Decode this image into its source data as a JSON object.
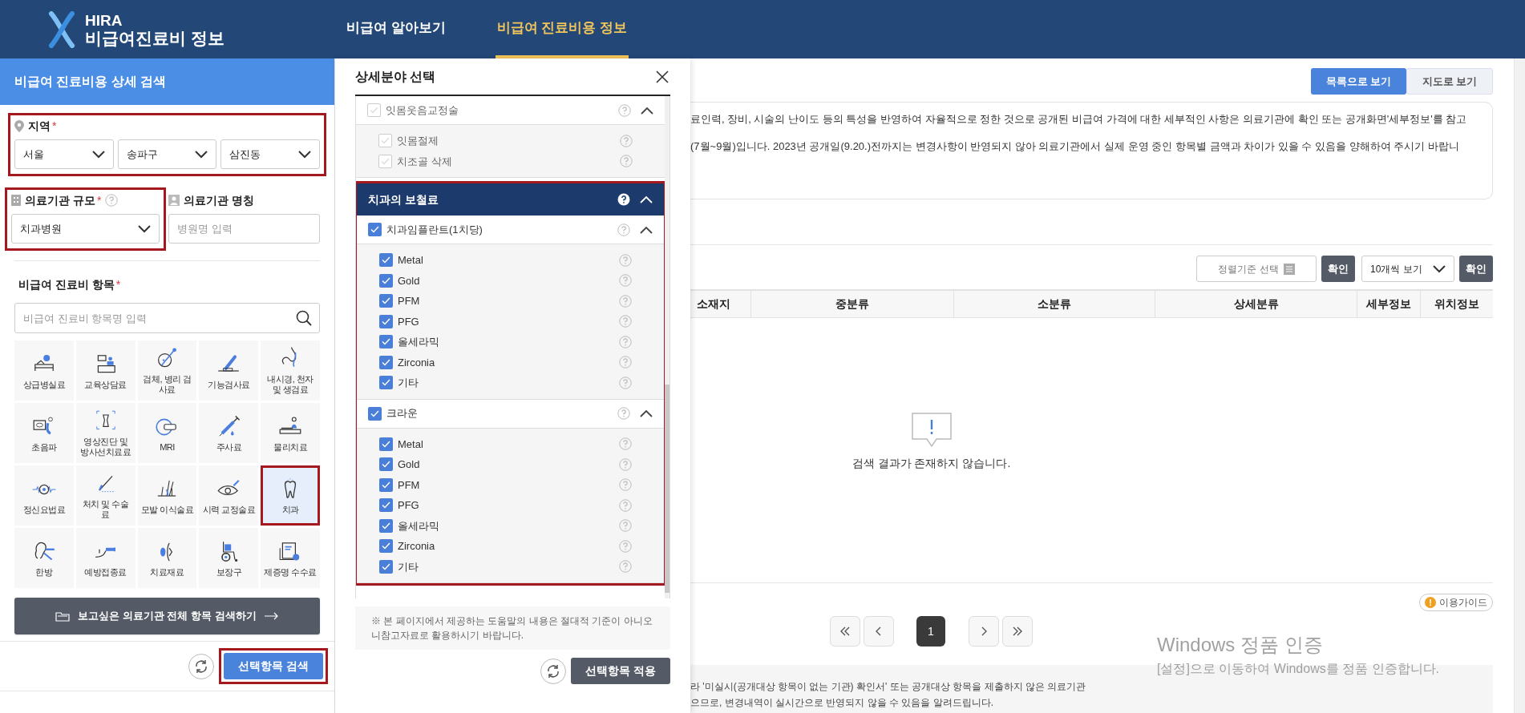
{
  "header": {
    "title_top": "HIRA",
    "title_bottom": "비급여진료비 정보",
    "nav": [
      {
        "label": "비급여 알아보기",
        "selected": false
      },
      {
        "label": "비급여 진료비용 정보",
        "selected": true
      }
    ]
  },
  "search_panel": {
    "title": "비급여 진료비용 상세 검색",
    "region": {
      "label": "지역",
      "required": "*",
      "highlighted": true,
      "selects": [
        "서울",
        "송파구",
        "삼진동"
      ]
    },
    "scale": {
      "label": "의료기관 규모",
      "required": "*",
      "value": "치과병원",
      "highlighted": true
    },
    "name_field": {
      "label": "의료기관 명칭",
      "placeholder": "병원명 입력"
    },
    "items": {
      "label": "비급여 진료비 항목",
      "required": "*",
      "placeholder": "비급여 진료비 항목명 입력"
    },
    "categories": [
      {
        "label": "상급병실료",
        "selected": false,
        "highlighted": false
      },
      {
        "label": "교육상담료",
        "selected": false,
        "highlighted": false
      },
      {
        "label": "검체, 병리 검사료",
        "selected": false,
        "highlighted": false
      },
      {
        "label": "기능검사료",
        "selected": false,
        "highlighted": false
      },
      {
        "label": "내시경, 천자 및 생검료",
        "selected": false,
        "highlighted": false
      },
      {
        "label": "초음파",
        "selected": false,
        "highlighted": false
      },
      {
        "label": "영상진단 및 방사선치료료",
        "selected": false,
        "highlighted": false
      },
      {
        "label": "MRI",
        "selected": false,
        "highlighted": false
      },
      {
        "label": "주사료",
        "selected": false,
        "highlighted": false
      },
      {
        "label": "물리치료",
        "selected": false,
        "highlighted": false
      },
      {
        "label": "정신요법료",
        "selected": false,
        "highlighted": false
      },
      {
        "label": "처치 및 수술료",
        "selected": false,
        "highlighted": false
      },
      {
        "label": "모발 이식술료",
        "selected": false,
        "highlighted": false
      },
      {
        "label": "시력 교정술료",
        "selected": false,
        "highlighted": false
      },
      {
        "label": "치과",
        "selected": true,
        "highlighted": true
      },
      {
        "label": "한방",
        "selected": false,
        "highlighted": false
      },
      {
        "label": "예방접종료",
        "selected": false,
        "highlighted": false
      },
      {
        "label": "치료재료",
        "selected": false,
        "highlighted": false
      },
      {
        "label": "보장구",
        "selected": false,
        "highlighted": false
      },
      {
        "label": "제증명 수수료",
        "selected": false,
        "highlighted": false
      }
    ],
    "all_items_button": "보고싶은 의료기관 전체 항목 검색하기",
    "search_button": {
      "label": "선택항목 검색",
      "highlighted": true
    }
  },
  "detail_panel": {
    "title": "상세분야 선택",
    "groups": [
      {
        "label": "잇몸웃음교정술",
        "checked": false,
        "expanded": true,
        "children": [
          {
            "label": "잇몸절제",
            "checked": false
          },
          {
            "label": "치조골 삭제",
            "checked": false
          }
        ]
      }
    ],
    "sections": [
      {
        "title": "치과의 보철료",
        "highlighted": true,
        "expanded": true,
        "groups": [
          {
            "label": "치과임플란트(1치당)",
            "checked": true,
            "expanded": true,
            "children": [
              {
                "label": "Metal",
                "checked": true
              },
              {
                "label": "Gold",
                "checked": true
              },
              {
                "label": "PFM",
                "checked": true
              },
              {
                "label": "PFG",
                "checked": true
              },
              {
                "label": "올세라믹",
                "checked": true
              },
              {
                "label": "Zirconia",
                "checked": true
              },
              {
                "label": "기타",
                "checked": true
              }
            ]
          },
          {
            "label": "크라운",
            "checked": true,
            "expanded": true,
            "children": [
              {
                "label": "Metal",
                "checked": true
              },
              {
                "label": "Gold",
                "checked": true
              },
              {
                "label": "PFM",
                "checked": true
              },
              {
                "label": "PFG",
                "checked": true
              },
              {
                "label": "올세라믹",
                "checked": true
              },
              {
                "label": "Zirconia",
                "checked": true
              },
              {
                "label": "기타",
                "checked": true
              }
            ]
          }
        ]
      }
    ],
    "note": "※ 본 페이지에서 제공하는 도움말의 내용은 절대적 기준이 아니오니참고자료로 활용하시기 바랍니다.",
    "apply_button": "선택항목 적용"
  },
  "main": {
    "view_tabs": [
      {
        "label": "목록으로 보기",
        "selected": true
      },
      {
        "label": "지도로 보기",
        "selected": false
      }
    ],
    "notice": [
      "료인력, 장비, 시술의 난이도 등의 특성을 반영하여 자율적으로 정한 것으로 공개된 비급여 가격에 대한 세부적인 사항은 의료기관에 확인 또는 공개화면'세부정보'를 참고",
      "(7월~9월)입니다. 2023년 공개일(9.20.)전까지는 변경사항이 반영되지 않아 의료기관에서 실제 운영 중인 항목별 금액과 차이가 있을 수 있음을 양해하여 주시기 바랍니"
    ],
    "sort": {
      "placeholder": "정렬기준 선택",
      "confirm": "확인"
    },
    "page_size": {
      "value": "10개씩 보기",
      "confirm": "확인"
    },
    "table": {
      "columns": [
        "소재지",
        "중분류",
        "소분류",
        "상세분류",
        "세부정보",
        "위치정보"
      ],
      "empty_message": "검색 결과가 존재하지 않습니다."
    },
    "guide": "이용가이드",
    "pagination": {
      "pages": [
        {
          "label": "1",
          "selected": true
        }
      ]
    },
    "footer_notes": [
      "라 '미실시(공개대상 항목이 없는 기관) 확인서' 또는 공개대상 항목을 제출하지 않은 의료기관",
      "으므로, 변경내역이 실시간으로 반영되지 않을 수 있음을 알려드립니다."
    ]
  },
  "os_notice": {
    "title": "Windows 정품 인증",
    "message": "[설정]으로 이동하여 Windows를 정품 인증합니다."
  }
}
